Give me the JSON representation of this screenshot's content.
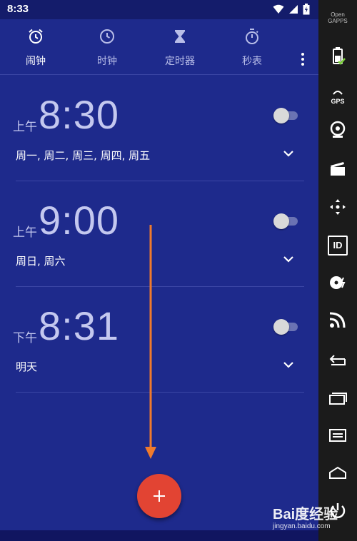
{
  "status_bar": {
    "time": "8:33"
  },
  "tabs": [
    {
      "label": "闹钟",
      "icon": "alarm-clock-icon",
      "active": true
    },
    {
      "label": "时钟",
      "icon": "clock-icon",
      "active": false
    },
    {
      "label": "定时器",
      "icon": "hourglass-icon",
      "active": false
    },
    {
      "label": "秒表",
      "icon": "stopwatch-icon",
      "active": false
    }
  ],
  "alarms": [
    {
      "ampm": "上午",
      "time": "8:30",
      "days": "周一, 周二, 周三, 周四, 周五",
      "enabled": false
    },
    {
      "ampm": "上午",
      "time": "9:00",
      "days": "周日, 周六",
      "enabled": false
    },
    {
      "ampm": "下午",
      "time": "8:31",
      "days": "明天",
      "enabled": false
    }
  ],
  "fab": {
    "icon": "plus-icon"
  },
  "sidebar": {
    "logo_line1": "Open",
    "logo_line2": "GAPPS",
    "gps_label": "GPS",
    "id_label": "ID"
  },
  "watermark": {
    "main": "Bai度经验",
    "sub": "jingyan.baidu.com"
  },
  "colors": {
    "background": "#1e2a8c",
    "statusbar": "#141c6b",
    "fab": "#e24433",
    "arrow": "#f07a2c"
  }
}
